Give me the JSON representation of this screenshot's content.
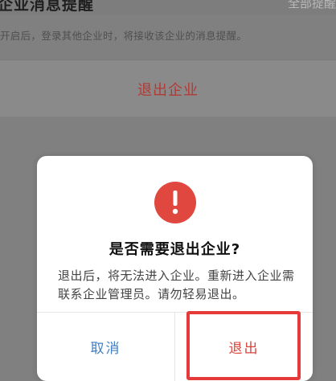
{
  "background": {
    "title": "企业消息提醒",
    "right_label": "全部提醒",
    "description": "开启后，登录其他企业时，将接收该企业的消息提醒。",
    "exit_link": "退出企业"
  },
  "dialog": {
    "icon": "exclamation-icon",
    "title": "是否需要退出企业?",
    "message": "退出后，将无法进入企业。重新进入企业需联系企业管理员。请勿轻易退出。",
    "cancel_label": "取消",
    "exit_label": "退出"
  },
  "colors": {
    "accent_red": "#e0473f",
    "cancel_blue": "#3f7fc4",
    "highlight_box": "#e63a3a"
  }
}
